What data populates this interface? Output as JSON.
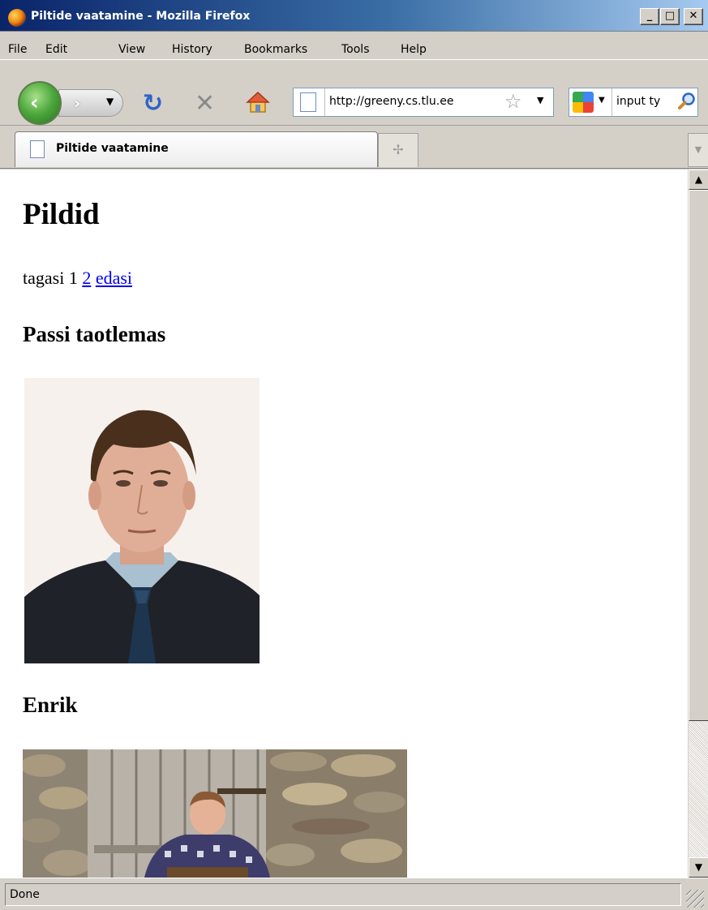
{
  "window": {
    "title": "Piltide vaatamine - Mozilla Firefox",
    "minimize_label": "_",
    "maximize_label": "□",
    "close_label": "✕"
  },
  "menu": [
    "File",
    "Edit",
    "View",
    "History",
    "Bookmarks",
    "Tools",
    "Help"
  ],
  "nav": {
    "url": "http://greeny.cs.tlu.ee",
    "search_text": "input ty"
  },
  "tabs": [
    {
      "label": "Piltide vaatamine",
      "active": true
    }
  ],
  "page": {
    "heading": "Pildid",
    "pager": {
      "prev_label": "tagasi",
      "current_page": "1",
      "next_page_link": "2",
      "next_label": "edasi"
    },
    "images": [
      {
        "title": "Passi taotlemas"
      },
      {
        "title": "Enrik"
      }
    ]
  },
  "status": {
    "text": "Done"
  },
  "colors": {
    "link": "#0000ee",
    "chrome": "#d4d0c8",
    "titlebar_start": "#0a246a",
    "titlebar_end": "#a6caf0"
  }
}
